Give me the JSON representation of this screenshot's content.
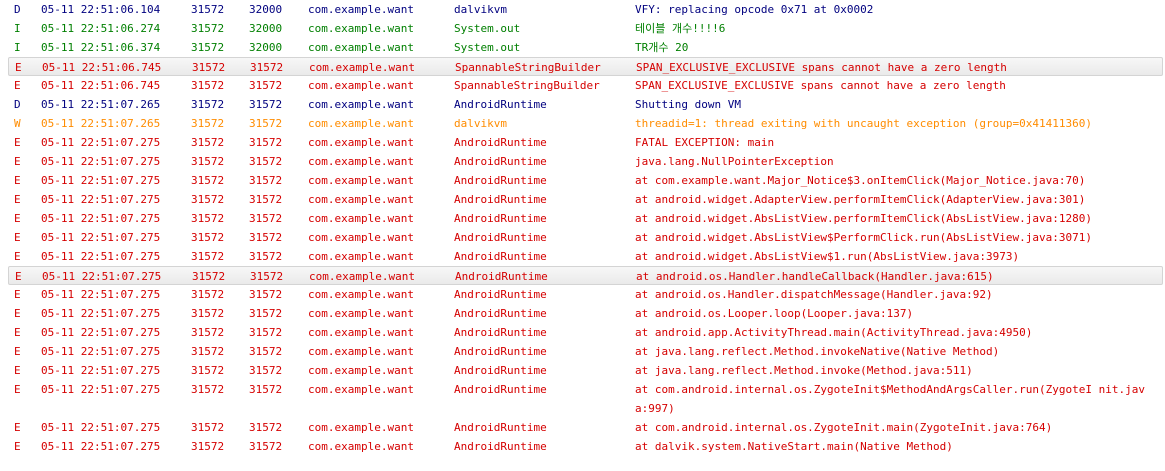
{
  "colors": {
    "D": "#00007f",
    "I": "#007f00",
    "E": "#d50000",
    "W": "#ff8c00"
  },
  "rows": [
    {
      "level": "D",
      "time": "05-11 22:51:06.104",
      "pid": "31572",
      "tid": "32000",
      "app": "com.example.want",
      "tag": "dalvikvm",
      "text": "VFY: replacing opcode 0x71 at 0x0002"
    },
    {
      "level": "I",
      "time": "05-11 22:51:06.274",
      "pid": "31572",
      "tid": "32000",
      "app": "com.example.want",
      "tag": "System.out",
      "text": "테이블 개수!!!!6"
    },
    {
      "level": "I",
      "time": "05-11 22:51:06.374",
      "pid": "31572",
      "tid": "32000",
      "app": "com.example.want",
      "tag": "System.out",
      "text": "TR개수 20"
    },
    {
      "level": "E",
      "time": "05-11 22:51:06.745",
      "pid": "31572",
      "tid": "31572",
      "app": "com.example.want",
      "tag": "SpannableStringBuilder",
      "text": "SPAN_EXCLUSIVE_EXCLUSIVE spans cannot have a zero length",
      "highlight": true
    },
    {
      "level": "E",
      "time": "05-11 22:51:06.745",
      "pid": "31572",
      "tid": "31572",
      "app": "com.example.want",
      "tag": "SpannableStringBuilder",
      "text": "SPAN_EXCLUSIVE_EXCLUSIVE spans cannot have a zero length"
    },
    {
      "level": "D",
      "time": "05-11 22:51:07.265",
      "pid": "31572",
      "tid": "31572",
      "app": "com.example.want",
      "tag": "AndroidRuntime",
      "text": "Shutting down VM"
    },
    {
      "level": "W",
      "time": "05-11 22:51:07.265",
      "pid": "31572",
      "tid": "31572",
      "app": "com.example.want",
      "tag": "dalvikvm",
      "text": "threadid=1: thread exiting with uncaught exception (group=0x41411360)"
    },
    {
      "level": "E",
      "time": "05-11 22:51:07.275",
      "pid": "31572",
      "tid": "31572",
      "app": "com.example.want",
      "tag": "AndroidRuntime",
      "text": "FATAL EXCEPTION: main"
    },
    {
      "level": "E",
      "time": "05-11 22:51:07.275",
      "pid": "31572",
      "tid": "31572",
      "app": "com.example.want",
      "tag": "AndroidRuntime",
      "text": "java.lang.NullPointerException"
    },
    {
      "level": "E",
      "time": "05-11 22:51:07.275",
      "pid": "31572",
      "tid": "31572",
      "app": "com.example.want",
      "tag": "AndroidRuntime",
      "text": "at com.example.want.Major_Notice$3.onItemClick(Major_Notice.java:70)"
    },
    {
      "level": "E",
      "time": "05-11 22:51:07.275",
      "pid": "31572",
      "tid": "31572",
      "app": "com.example.want",
      "tag": "AndroidRuntime",
      "text": "at android.widget.AdapterView.performItemClick(AdapterView.java:301)"
    },
    {
      "level": "E",
      "time": "05-11 22:51:07.275",
      "pid": "31572",
      "tid": "31572",
      "app": "com.example.want",
      "tag": "AndroidRuntime",
      "text": "at android.widget.AbsListView.performItemClick(AbsListView.java:1280)"
    },
    {
      "level": "E",
      "time": "05-11 22:51:07.275",
      "pid": "31572",
      "tid": "31572",
      "app": "com.example.want",
      "tag": "AndroidRuntime",
      "text": "at android.widget.AbsListView$PerformClick.run(AbsListView.java:3071)"
    },
    {
      "level": "E",
      "time": "05-11 22:51:07.275",
      "pid": "31572",
      "tid": "31572",
      "app": "com.example.want",
      "tag": "AndroidRuntime",
      "text": "at android.widget.AbsListView$1.run(AbsListView.java:3973)"
    },
    {
      "level": "E",
      "time": "05-11 22:51:07.275",
      "pid": "31572",
      "tid": "31572",
      "app": "com.example.want",
      "tag": "AndroidRuntime",
      "text": "at android.os.Handler.handleCallback(Handler.java:615)",
      "highlight": true
    },
    {
      "level": "E",
      "time": "05-11 22:51:07.275",
      "pid": "31572",
      "tid": "31572",
      "app": "com.example.want",
      "tag": "AndroidRuntime",
      "text": "at android.os.Handler.dispatchMessage(Handler.java:92)"
    },
    {
      "level": "E",
      "time": "05-11 22:51:07.275",
      "pid": "31572",
      "tid": "31572",
      "app": "com.example.want",
      "tag": "AndroidRuntime",
      "text": "at android.os.Looper.loop(Looper.java:137)"
    },
    {
      "level": "E",
      "time": "05-11 22:51:07.275",
      "pid": "31572",
      "tid": "31572",
      "app": "com.example.want",
      "tag": "AndroidRuntime",
      "text": "at android.app.ActivityThread.main(ActivityThread.java:4950)"
    },
    {
      "level": "E",
      "time": "05-11 22:51:07.275",
      "pid": "31572",
      "tid": "31572",
      "app": "com.example.want",
      "tag": "AndroidRuntime",
      "text": "at java.lang.reflect.Method.invokeNative(Native Method)"
    },
    {
      "level": "E",
      "time": "05-11 22:51:07.275",
      "pid": "31572",
      "tid": "31572",
      "app": "com.example.want",
      "tag": "AndroidRuntime",
      "text": "at java.lang.reflect.Method.invoke(Method.java:511)"
    },
    {
      "level": "E",
      "time": "05-11 22:51:07.275",
      "pid": "31572",
      "tid": "31572",
      "app": "com.example.want",
      "tag": "AndroidRuntime",
      "text": "at com.android.internal.os.ZygoteInit$MethodAndArgsCaller.run(ZygoteI nit.java:997)",
      "tall": true
    },
    {
      "level": "E",
      "time": "05-11 22:51:07.275",
      "pid": "31572",
      "tid": "31572",
      "app": "com.example.want",
      "tag": "AndroidRuntime",
      "text": "at com.android.internal.os.ZygoteInit.main(ZygoteInit.java:764)"
    },
    {
      "level": "E",
      "time": "05-11 22:51:07.275",
      "pid": "31572",
      "tid": "31572",
      "app": "com.example.want",
      "tag": "AndroidRuntime",
      "text": "at dalvik.system.NativeStart.main(Native Method)"
    }
  ]
}
